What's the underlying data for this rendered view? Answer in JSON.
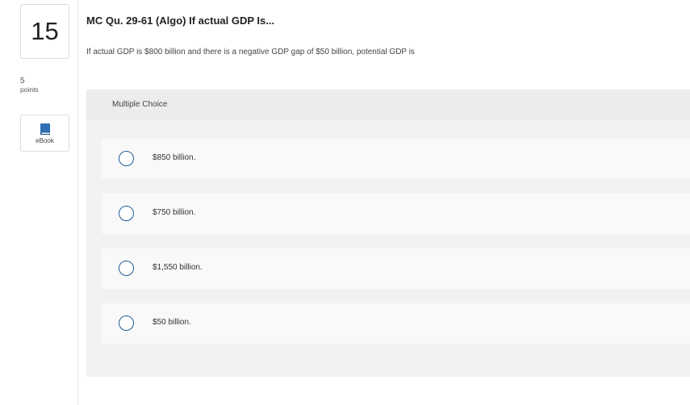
{
  "question": {
    "number": "15",
    "points_value": "5",
    "points_label": "points",
    "title": "MC Qu. 29-61 (Algo) If actual GDP Is...",
    "text": "If actual GDP is $800 billion and there is a negative GDP gap of $50 billion, potential GDP is"
  },
  "ebook": {
    "label": "eBook",
    "icon": "book-icon"
  },
  "multiple_choice": {
    "header": "Multiple Choice",
    "options": [
      {
        "label": "$850 billion."
      },
      {
        "label": "$750 billion."
      },
      {
        "label": "$1,550 billion."
      },
      {
        "label": "$50 billion."
      }
    ]
  },
  "colors": {
    "radio_border": "#1f5c99",
    "ebook_icon": "#2f6fb5",
    "panel_bg": "#f2f2f2",
    "option_bg": "#f9f9f9"
  }
}
